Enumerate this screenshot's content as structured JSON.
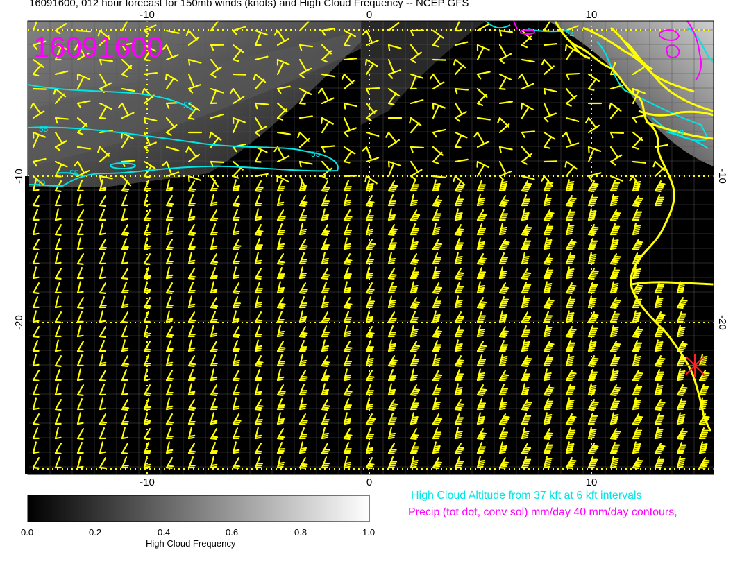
{
  "title": "16091600, 012 hour forecast for 150mb winds (knots) and High Cloud Frequency -- NCEP GFS",
  "stamp": "16091600",
  "colors": {
    "barb": "#ffff00",
    "cyan": "#00e5e5",
    "magenta": "#ff00ff",
    "coast": "#ffff00",
    "marker": "#ff2020"
  },
  "axes": {
    "lon_ticks": [
      "-10",
      "0",
      "10"
    ],
    "lat_ticks": [
      "-10",
      "-20"
    ]
  },
  "contour_labels": [
    "55",
    "55",
    "55",
    "55",
    "49",
    "49",
    "24"
  ],
  "colorbar": {
    "ticks": [
      "0.0",
      "0.2",
      "0.4",
      "0.6",
      "0.8",
      "1.0"
    ],
    "label": "High Cloud Frequency"
  },
  "legend": {
    "cloud_altitude": "High Cloud Altitude from 37 kft at 6 kft intervals",
    "precip": "Precip (tot dot, conv sol) mm/day 40 mm/day contours,"
  }
}
